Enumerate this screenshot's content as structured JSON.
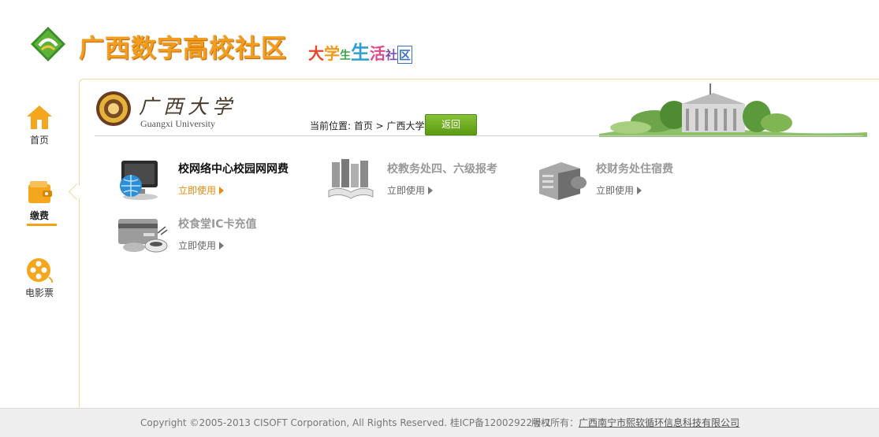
{
  "header": {
    "title": "广西数字高校社区",
    "slogan": [
      "大",
      "学",
      "生",
      "生",
      "活",
      "社",
      "区"
    ]
  },
  "sidenav": {
    "items": [
      {
        "label": "首页"
      },
      {
        "label": "缴费"
      },
      {
        "label": "电影票"
      }
    ],
    "active_index": 1
  },
  "university": {
    "name_cn": "广西大学",
    "name_en": "Guangxi University"
  },
  "breadcrumb": {
    "text": "当前位置: 首页 > 广西大学",
    "back_label": "返回"
  },
  "services": [
    {
      "title": "校网络中心校园网网费",
      "link": "立即使用",
      "active": true,
      "icon": "computer-globe-icon"
    },
    {
      "title": "校教务处四、六级报考",
      "link": "立即使用",
      "active": false,
      "icon": "books-icon"
    },
    {
      "title": "校财务处住宿费",
      "link": "立即使用",
      "active": false,
      "icon": "building-icon"
    },
    {
      "title": "校食堂IC卡充值",
      "link": "立即使用",
      "active": false,
      "icon": "card-bowl-icon"
    }
  ],
  "footer": {
    "copyright": "Copyright ©2005-2013 CISOFT Corporation, All Rights Reserved. 桂ICP备12002922号-1",
    "owner_label": "版权所有：",
    "owner_name": "广西南宁市熙软循环信息科技有限公司"
  },
  "colors": {
    "brand_orange": "#f29d1c",
    "accent_green": "#6aaa1f",
    "link_orange": "#e88a0c"
  }
}
